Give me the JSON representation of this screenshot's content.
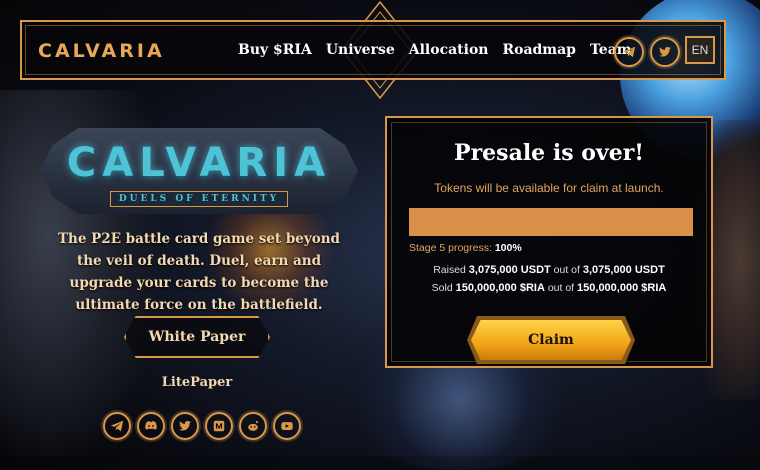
{
  "header": {
    "logo": "CALVARIA",
    "menu": [
      "Buy $RIA",
      "Universe",
      "Allocation",
      "Roadmap",
      "Team"
    ],
    "social_icons": [
      "telegram-icon",
      "twitter-icon"
    ],
    "language": "EN"
  },
  "hero": {
    "logo_title": "CALVARIA",
    "logo_subtitle": "DUELS OF ETERNITY",
    "tagline": "The P2E battle card game set beyond the veil of death. Duel, earn and upgrade your cards to become the ultimate force on the battlefield.",
    "white_paper_label": "White Paper",
    "litepaper_label": "LitePaper",
    "social_icons": [
      "telegram-icon",
      "discord-icon",
      "twitter-icon",
      "medium-icon",
      "reddit-icon",
      "youtube-icon"
    ]
  },
  "presale": {
    "title": "Presale is over!",
    "note": "Tokens will be available for claim at launch.",
    "progress_label": "Stage 5 progress:",
    "progress_value": "100%",
    "progress_fraction": 1.0,
    "raised_prefix": "Raised",
    "raised_amount": "3,075,000 USDT",
    "raised_of": "out of",
    "raised_total": "3,075,000 USDT",
    "sold_prefix": "Sold",
    "sold_amount": "150,000,000 $RIA",
    "sold_of": "out of",
    "sold_total": "150,000,000 $RIA",
    "claim_label": "Claim"
  },
  "colors": {
    "accent": "#d9974a",
    "cyan": "#4fc3d6",
    "claim": "#f2a516"
  }
}
